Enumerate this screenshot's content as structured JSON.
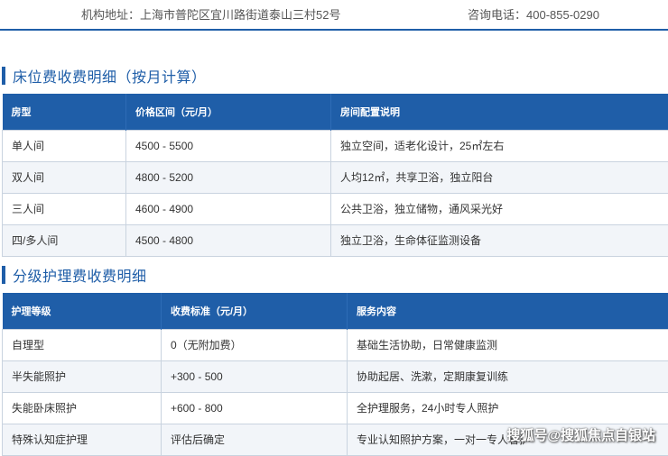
{
  "info": {
    "address": "机构地址：上海市普陀区宜川路街道泰山三村52号",
    "phone": "咨询电话：400-855-0290"
  },
  "bed_section": {
    "title": "床位费收费明细（按月计算）",
    "headers": [
      "房型",
      "价格区间（元/月）",
      "房间配置说明"
    ],
    "rows": [
      [
        "单人间",
        "4500 - 5500",
        "独立空间，适老化设计，25㎡左右"
      ],
      [
        "双人间",
        "4800 - 5200",
        "人均12㎡，共享卫浴，独立阳台"
      ],
      [
        "三人间",
        "4600 - 4900",
        "公共卫浴，独立储物，通风采光好"
      ],
      [
        "四/多人间",
        "4500 - 4800",
        "独立卫浴，生命体征监测设备"
      ]
    ]
  },
  "care_section": {
    "title": "分级护理费收费明细",
    "headers": [
      "护理等级",
      "收费标准（元/月）",
      "服务内容"
    ],
    "rows": [
      [
        "自理型",
        "0（无附加费）",
        "基础生活协助，日常健康监测"
      ],
      [
        "半失能照护",
        "+300 - 500",
        "协助起居、洗漱，定期康复训练"
      ],
      [
        "失能卧床照护",
        "+600 - 800",
        "全护理服务，24小时专人照护"
      ],
      [
        "特殊认知症护理",
        "评估后确定",
        "专业认知照护方案，一对一专人看护"
      ]
    ]
  },
  "watermark": "搜狐号@搜狐焦点自银站"
}
